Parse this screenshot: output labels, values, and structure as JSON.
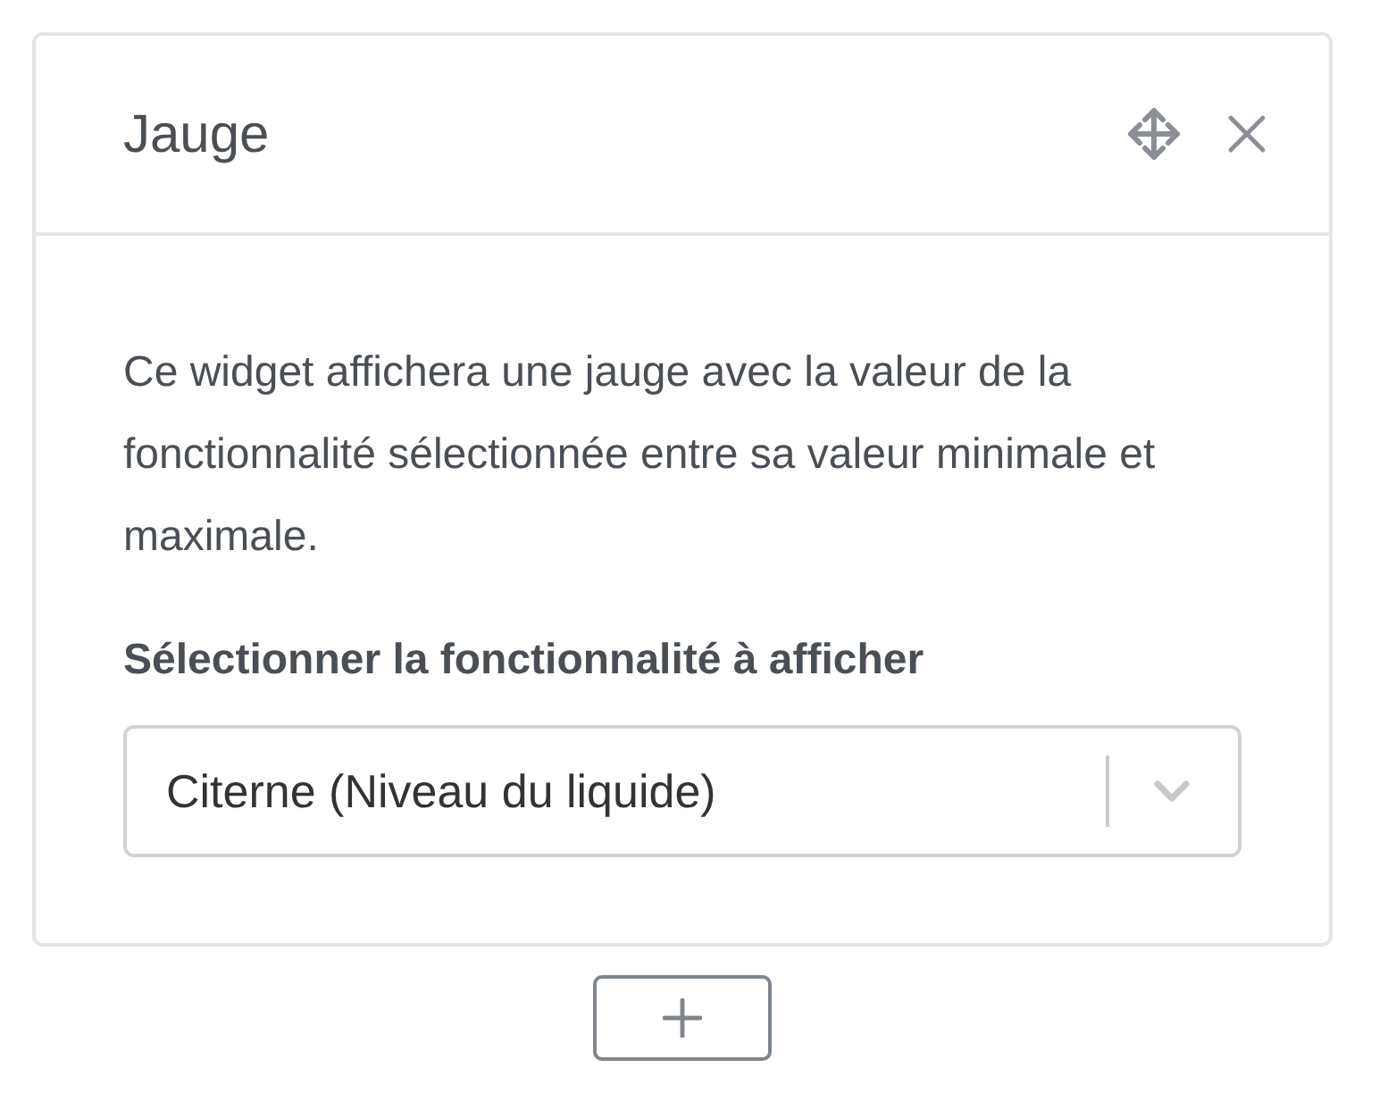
{
  "widget": {
    "title": "Jauge",
    "description": "Ce widget affichera une jauge avec la valeur de la fonctionnalité sélectionnée entre sa valeur minimale et maximale.",
    "field_label": "Sélectionner la fonctionnalité à afficher",
    "select": {
      "value": "Citerne (Niveau du liquide)"
    }
  }
}
